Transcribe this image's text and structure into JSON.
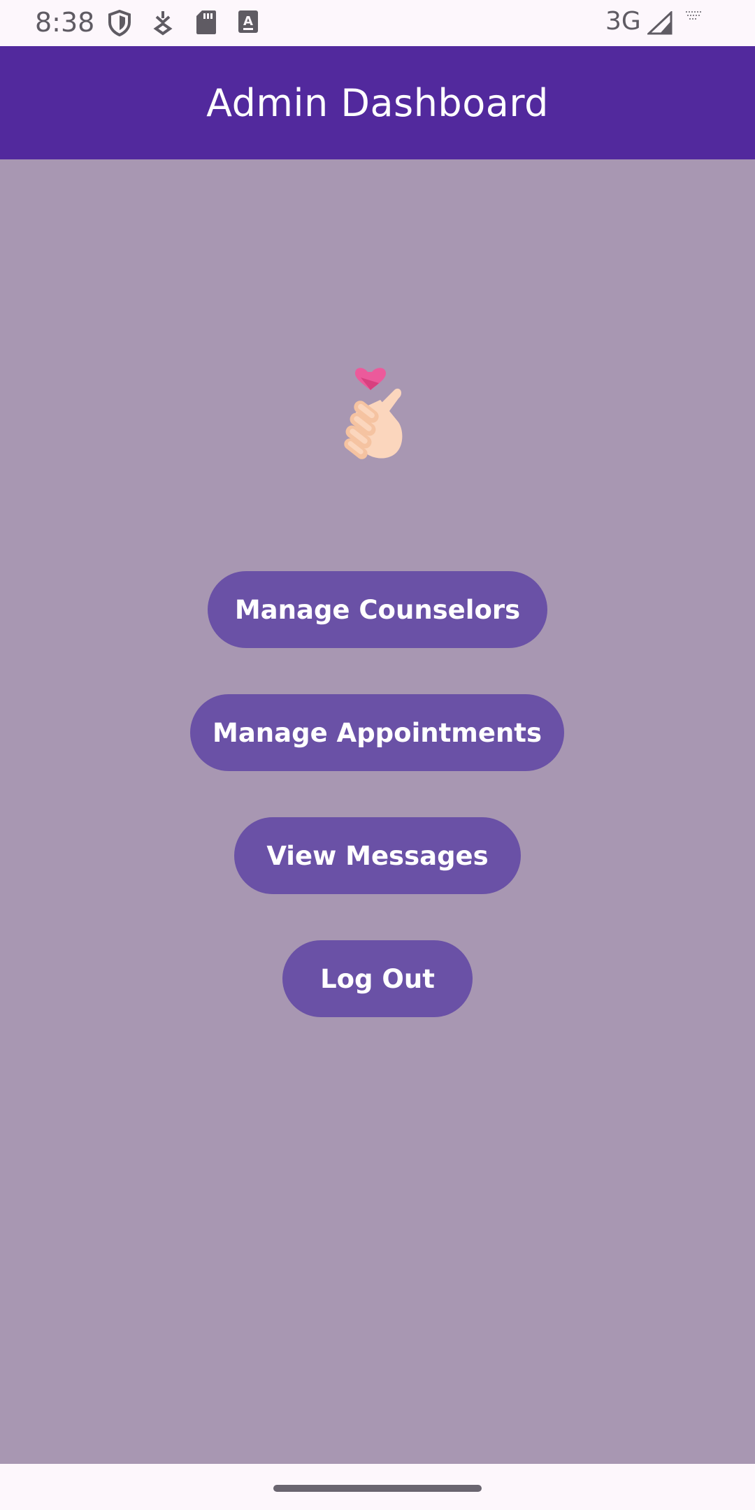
{
  "status_bar": {
    "time": "8:38",
    "network": "3G",
    "icons": [
      "shield-icon",
      "download-icon",
      "sd-card-icon",
      "keyboard-icon",
      "signal-icon",
      "wifi-icon"
    ]
  },
  "app_bar": {
    "title": "Admin Dashboard"
  },
  "logo": {
    "icon": "finger-heart-icon"
  },
  "menu": {
    "manage_counselors": "Manage Counselors",
    "manage_appointments": "Manage Appointments",
    "view_messages": "View Messages",
    "log_out": "Log Out"
  },
  "colors": {
    "app_bar": "#52299d",
    "background": "#a897b2",
    "button": "#6a51a6",
    "heart": "#ec5a9b",
    "hand": "#fbd6bd"
  }
}
